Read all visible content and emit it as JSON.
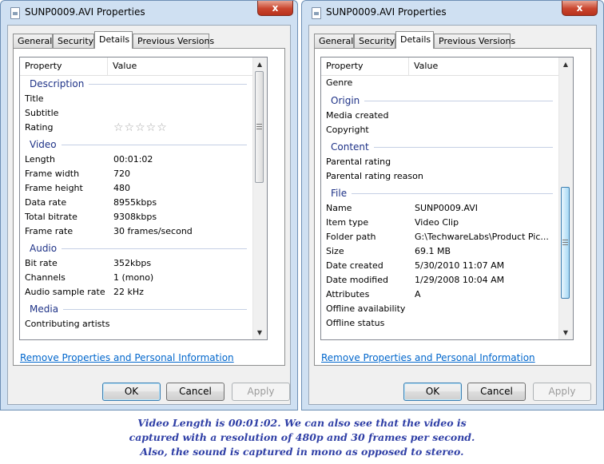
{
  "left_window": {
    "title": "SUNP0009.AVI Properties",
    "close_label": "x",
    "tabs": [
      "General",
      "Security",
      "Details",
      "Previous Versions"
    ],
    "columns": {
      "property": "Property",
      "value": "Value"
    },
    "sections": {
      "description": "Description",
      "video": "Video",
      "audio": "Audio",
      "media": "Media"
    },
    "description_rows": [
      {
        "property": "Title",
        "value": ""
      },
      {
        "property": "Subtitle",
        "value": ""
      }
    ],
    "rating": {
      "property": "Rating",
      "stars": "☆☆☆☆☆"
    },
    "video_rows": [
      {
        "property": "Length",
        "value": "00:01:02"
      },
      {
        "property": "Frame width",
        "value": "720"
      },
      {
        "property": "Frame height",
        "value": "480"
      },
      {
        "property": "Data rate",
        "value": "8955kbps"
      },
      {
        "property": "Total bitrate",
        "value": "9308kbps"
      },
      {
        "property": "Frame rate",
        "value": "30 frames/second"
      }
    ],
    "audio_rows": [
      {
        "property": "Bit rate",
        "value": "352kbps"
      },
      {
        "property": "Channels",
        "value": "1 (mono)"
      },
      {
        "property": "Audio sample rate",
        "value": "22 kHz"
      }
    ],
    "media_rows": [
      {
        "property": "Contributing artists",
        "value": ""
      }
    ],
    "remove_link": "Remove Properties and Personal Information",
    "buttons": {
      "ok": "OK",
      "cancel": "Cancel",
      "apply": "Apply"
    }
  },
  "right_window": {
    "title": "SUNP0009.AVI Properties",
    "close_label": "x",
    "tabs": [
      "General",
      "Security",
      "Details",
      "Previous Versions"
    ],
    "columns": {
      "property": "Property",
      "value": "Value"
    },
    "sections": {
      "origin": "Origin",
      "content": "Content",
      "file": "File"
    },
    "top_rows": [
      {
        "property": "Genre",
        "value": ""
      }
    ],
    "origin_rows": [
      {
        "property": "Media created",
        "value": ""
      },
      {
        "property": "Copyright",
        "value": ""
      }
    ],
    "content_rows": [
      {
        "property": "Parental rating",
        "value": ""
      },
      {
        "property": "Parental rating reason",
        "value": ""
      }
    ],
    "file_rows": [
      {
        "property": "Name",
        "value": "SUNP0009.AVI"
      },
      {
        "property": "Item type",
        "value": "Video Clip"
      },
      {
        "property": "Folder path",
        "value": "G:\\TechwareLabs\\Product Pic..."
      },
      {
        "property": "Size",
        "value": "69.1 MB"
      },
      {
        "property": "Date created",
        "value": "5/30/2010 11:07 AM"
      },
      {
        "property": "Date modified",
        "value": "1/29/2008 10:04 AM"
      },
      {
        "property": "Attributes",
        "value": "A"
      },
      {
        "property": "Offline availability",
        "value": ""
      },
      {
        "property": "Offline status",
        "value": ""
      }
    ],
    "remove_link": "Remove Properties and Personal Information",
    "buttons": {
      "ok": "OK",
      "cancel": "Cancel",
      "apply": "Apply"
    }
  },
  "caption": {
    "line1": "Video Length is 00:01:02. We can also see that the video is",
    "line2": "captured with a resolution of 480p and 30 frames per second.",
    "line3": "Also, the sound is captured in mono as opposed to stereo."
  },
  "colors": {
    "section_heading": "#1e3287",
    "link": "#0066cc",
    "caption": "#2f3fa6",
    "window_frame": "#cfe0f2",
    "close_button": "#c9452e"
  },
  "icons": {
    "title": "file-icon",
    "close": "close-icon",
    "scroll_up": "arrow-up-icon",
    "scroll_down": "arrow-down-icon",
    "rating": "star-icon"
  }
}
